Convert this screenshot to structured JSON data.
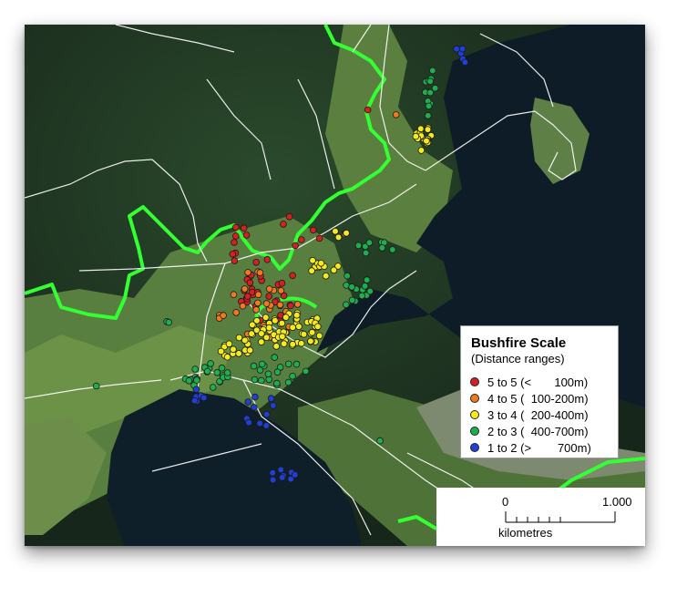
{
  "legend": {
    "title": "Bushfire Scale",
    "subtitle": "(Distance ranges)",
    "items": [
      {
        "label": "5 to 5 (<       100m)",
        "color": "#d61f1f"
      },
      {
        "label": "4 to 5 (  100-200m)",
        "color": "#f07a1c"
      },
      {
        "label": "3 to 4 (  200-400m)",
        "color": "#f5ea1a"
      },
      {
        "label": "2 to 3 (  400-700m)",
        "color": "#1fae4f"
      },
      {
        "label": "1 to 2 (>        700m)",
        "color": "#1f3fd6"
      }
    ]
  },
  "scale_bar": {
    "start_label": "0",
    "end_label": "1.000",
    "unit": "kilometres"
  },
  "colors": {
    "boundary": "#33ff33",
    "roads": "#ffffff",
    "water": "#0c1c26",
    "forest": "#1d3320",
    "pasture": "#4f7a3a"
  }
}
